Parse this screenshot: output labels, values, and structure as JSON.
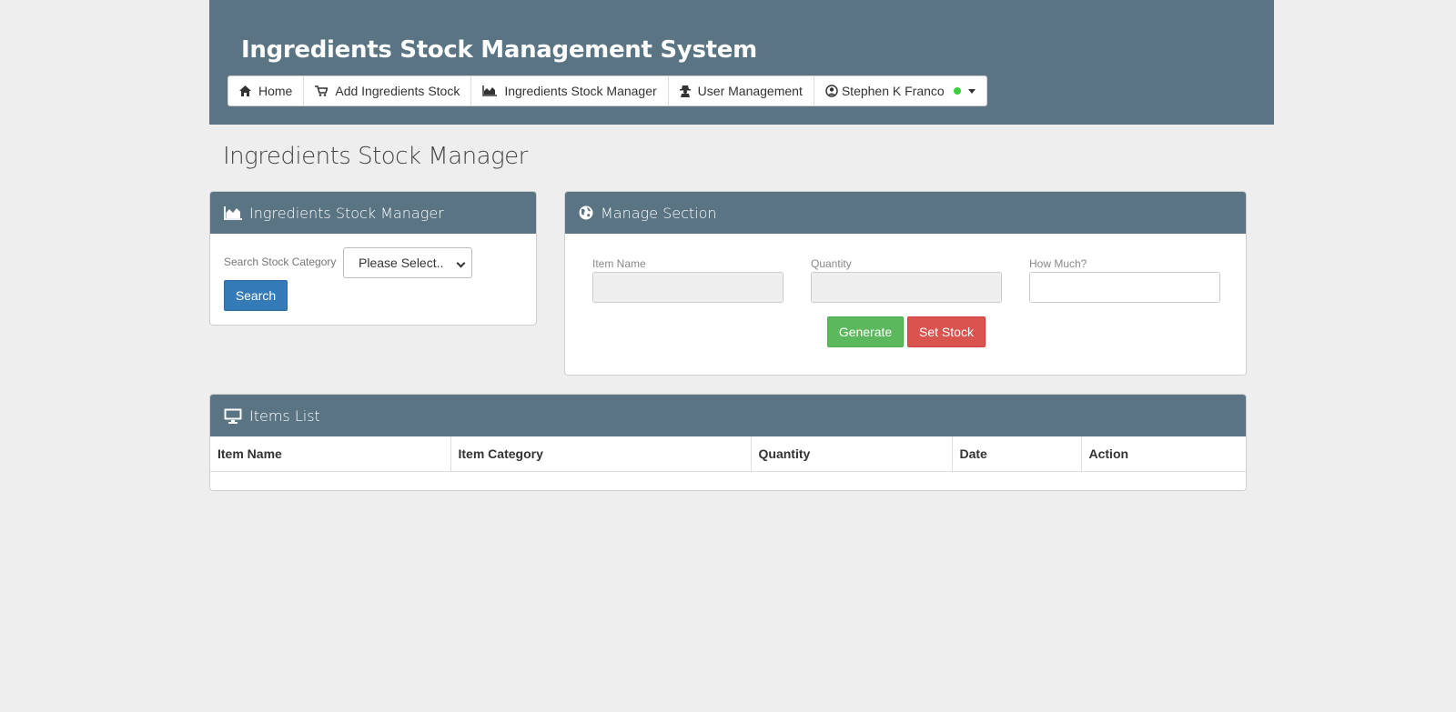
{
  "header": {
    "title": "Ingredients Stock Management System",
    "nav": [
      {
        "label": "Home",
        "icon": "home-icon"
      },
      {
        "label": "Add Ingredients Stock",
        "icon": "cart-icon"
      },
      {
        "label": "Ingredients Stock Manager",
        "icon": "area-chart-icon"
      },
      {
        "label": "User Management",
        "icon": "user-secret-icon"
      },
      {
        "label": "Stephen K Franco",
        "icon": "user-circle-icon"
      }
    ],
    "status_color": "#3ecf3e"
  },
  "page_title": "Ingredients Stock Manager",
  "search_panel": {
    "heading": "Ingredients Stock Manager",
    "label": "Search Stock Category",
    "select_value": "Please Select..",
    "search_button": "Search"
  },
  "manage_panel": {
    "heading": "Manage Section",
    "fields": [
      {
        "label": "Item Name",
        "value": ""
      },
      {
        "label": "Quantity",
        "value": ""
      },
      {
        "label": "How Much?",
        "value": ""
      }
    ],
    "generate_button": "Generate",
    "set_stock_button": "Set Stock"
  },
  "items_panel": {
    "heading": "Items List",
    "columns": [
      "Item Name",
      "Item Category",
      "Quantity",
      "Date",
      "Action"
    ]
  },
  "colors": {
    "header": "#5a7483",
    "background": "#eeeeee",
    "primary": "#337ab7",
    "success": "#5cb85c",
    "danger": "#d9534f"
  }
}
